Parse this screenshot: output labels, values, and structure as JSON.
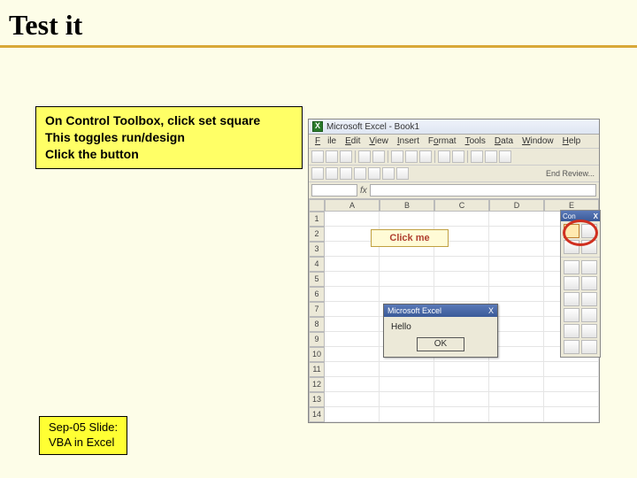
{
  "title": "Test it",
  "callout": {
    "line1": "On Control Toolbox, click set square",
    "line2": "This toggles run/design",
    "line3": "Click the button"
  },
  "footer": {
    "line1": "Sep-05 Slide:",
    "line2": "VBA in Excel"
  },
  "excel": {
    "app_title": "Microsoft Excel - Book1",
    "menu": {
      "file": "File",
      "edit": "Edit",
      "view": "View",
      "insert": "Insert",
      "format": "Format",
      "tools": "Tools",
      "data": "Data",
      "window": "Window",
      "help": "Help"
    },
    "end_review": "End Review...",
    "fx_label": "fx",
    "columns": [
      "A",
      "B",
      "C",
      "D",
      "E"
    ],
    "rows": [
      "1",
      "2",
      "3",
      "4",
      "5",
      "6",
      "7",
      "8",
      "9",
      "10",
      "11",
      "12",
      "13",
      "14"
    ],
    "button_label": "Click me",
    "toolbox": {
      "title": "Con",
      "close": "X"
    },
    "msgbox": {
      "title": "Microsoft Excel",
      "close": "X",
      "text": "Hello",
      "ok": "OK"
    }
  }
}
